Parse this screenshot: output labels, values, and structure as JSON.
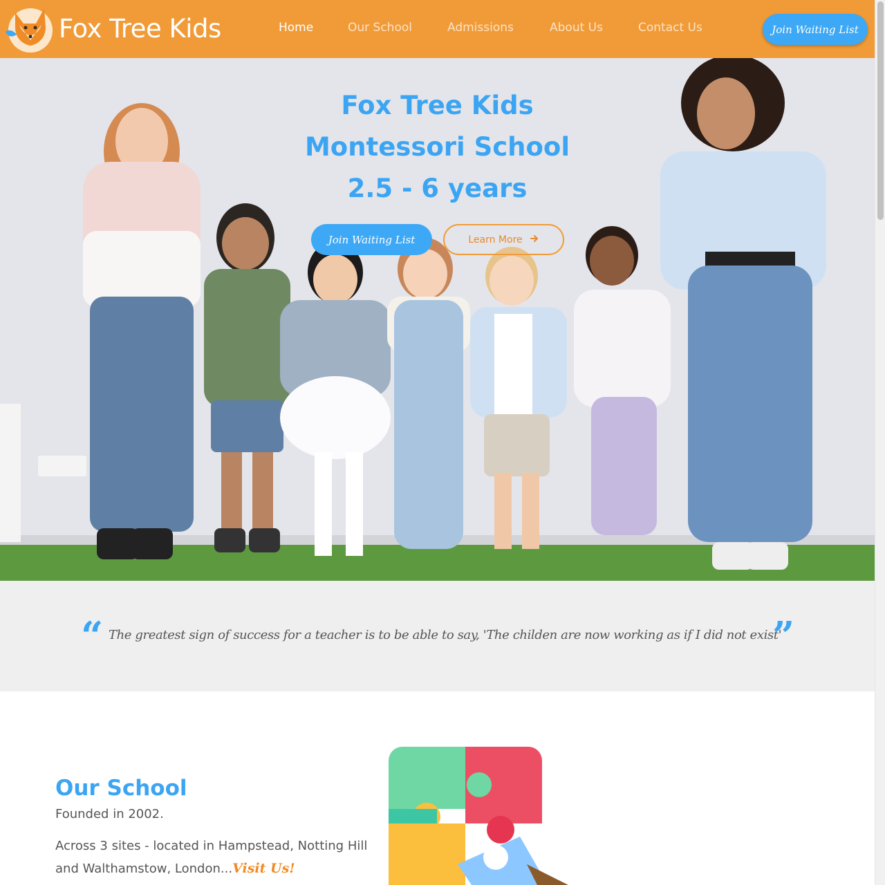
{
  "header": {
    "brand": "Fox Tree Kids",
    "cta_label": "Join Waiting List",
    "nav": [
      {
        "label": "Home",
        "active": true
      },
      {
        "label": "Our School",
        "active": false
      },
      {
        "label": "Admissions",
        "active": false
      },
      {
        "label": "About Us",
        "active": false
      },
      {
        "label": "Contact Us",
        "active": false
      }
    ]
  },
  "hero": {
    "title_line1": "Fox Tree Kids",
    "title_line2": "Montessori School",
    "title_line3": "2.5 - 6 years",
    "primary_label": "Join Waiting List",
    "secondary_label": "Learn More"
  },
  "quote": {
    "text": "The greatest sign of success for a teacher is to be able to say, 'The childen are now working as if I did not exist'"
  },
  "school": {
    "title": "Our School",
    "founded": "Founded in 2002.",
    "sites": "Across 3 sites - located in Hampstead, Notting Hill and Walthamstow, London...",
    "visit_label": "Visit Us!"
  },
  "colors": {
    "brand_orange": "#f19b38",
    "accent_blue": "#3da8f5",
    "text_gray": "#555555",
    "quote_band": "#efeff0"
  },
  "icons": [
    "fox-logo-icon",
    "arrow-right-icon",
    "quote-open-icon",
    "quote-close-icon"
  ]
}
